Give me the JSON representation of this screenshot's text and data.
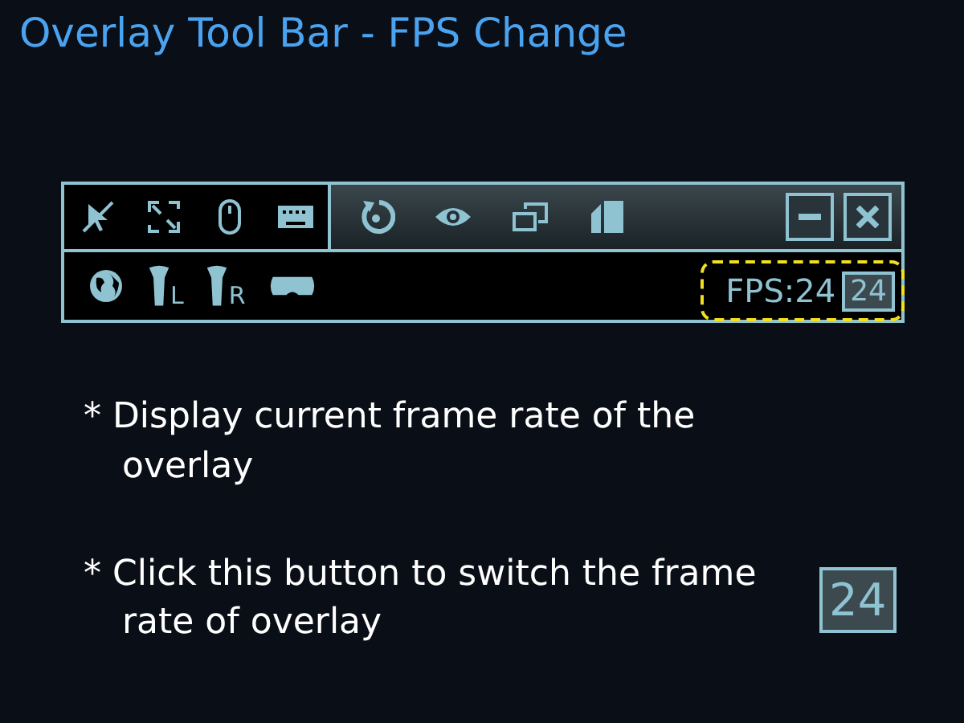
{
  "title": "Overlay Tool Bar - FPS Change",
  "toolbar": {
    "controller_labels": [
      "L",
      "R"
    ],
    "fps_reading": "FPS:24",
    "fps_button": "24"
  },
  "notes": [
    {
      "text": "* Display current frame rate of the overlay"
    },
    {
      "text": "* Click this button to switch the frame rate of overlay",
      "button": "24"
    }
  ]
}
